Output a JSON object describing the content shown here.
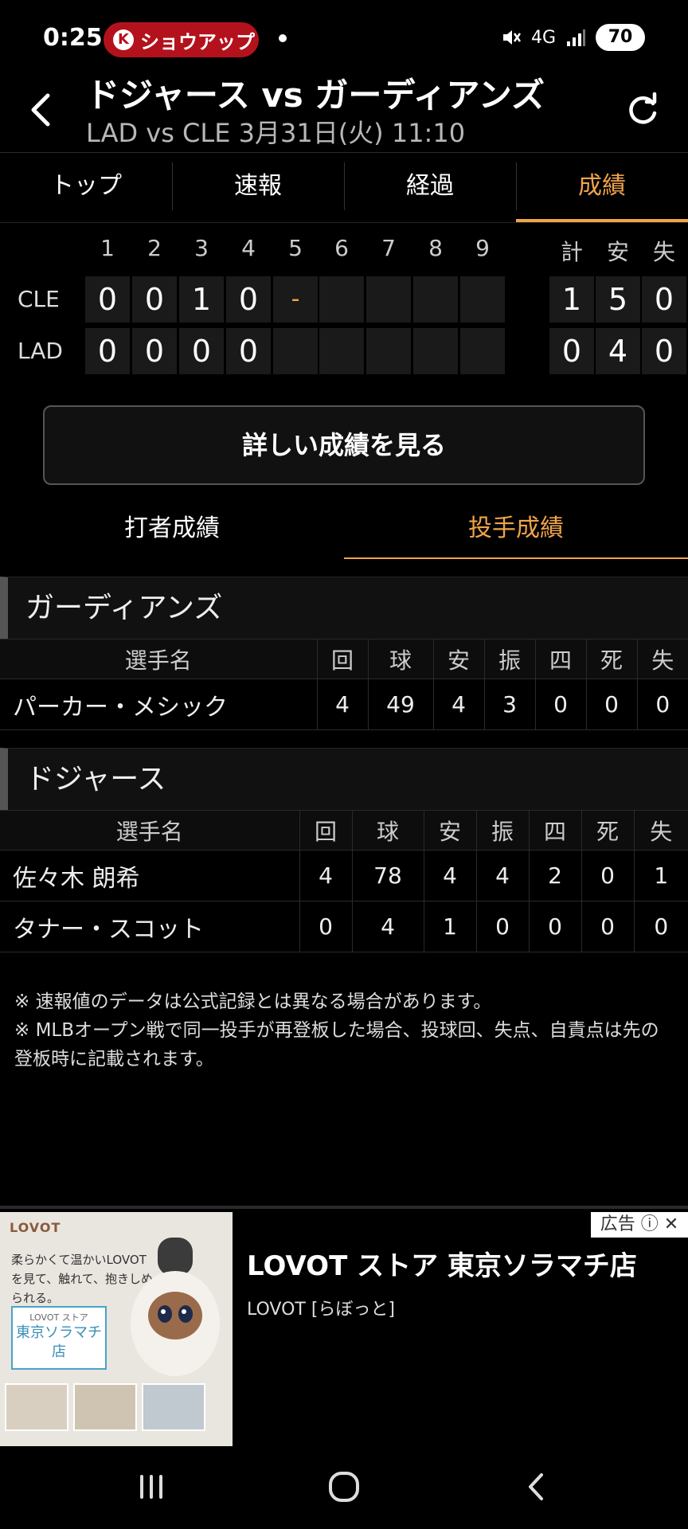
{
  "status_bar": {
    "time": "0:25",
    "notification_pill": "ショウアップ",
    "network": "4G",
    "battery": "70"
  },
  "header": {
    "title": "ドジャース vs ガーディアンズ",
    "subtitle": "LAD vs CLE 3月31日(火) 11:10"
  },
  "tabs": [
    "トップ",
    "速報",
    "経過",
    "成績"
  ],
  "active_tab": "成績",
  "scoreboard": {
    "innings": [
      "1",
      "2",
      "3",
      "4",
      "5",
      "6",
      "7",
      "8",
      "9"
    ],
    "totals_headers": [
      "計",
      "安",
      "失"
    ],
    "teams": [
      {
        "abbr": "CLE",
        "scores": [
          "0",
          "0",
          "1",
          "0",
          "-",
          "",
          "",
          "",
          ""
        ],
        "totals": [
          "1",
          "5",
          "0"
        ]
      },
      {
        "abbr": "LAD",
        "scores": [
          "0",
          "0",
          "0",
          "0",
          "",
          "",
          "",
          "",
          ""
        ],
        "totals": [
          "0",
          "4",
          "0"
        ]
      }
    ]
  },
  "detail_button": "詳しい成績を見る",
  "stat_tabs": {
    "batting": "打者成績",
    "pitching": "投手成績"
  },
  "pitching": {
    "columns": [
      "選手名",
      "回",
      "球",
      "安",
      "振",
      "四",
      "死",
      "失"
    ],
    "teams": [
      {
        "name": "ガーディアンズ",
        "rows": [
          [
            "パーカー・メシック",
            "4",
            "49",
            "4",
            "3",
            "0",
            "0",
            "0"
          ]
        ]
      },
      {
        "name": "ドジャース",
        "rows": [
          [
            "佐々木 朗希",
            "4",
            "78",
            "4",
            "4",
            "2",
            "0",
            "1"
          ],
          [
            "タナー・スコット",
            "0",
            "4",
            "1",
            "0",
            "0",
            "0",
            "0"
          ]
        ]
      }
    ]
  },
  "notes": [
    "※ 速報値のデータは公式記録とは異なる場合があります。",
    "※ MLBオープン戦で同一投手が再登板した場合、投球回、失点、自責点は先の登板時に記載されます。"
  ],
  "ad": {
    "label": "広告",
    "logo": "LOVOT",
    "image_copy": "柔らかくて温かいLOVOTを見て、触れて、抱きしめられる。",
    "image_store_small": "LOVOT ストア",
    "image_store": "東京ソラマチ店",
    "title": "LOVOT ストア 東京ソラマチ店",
    "subtitle": "LOVOT [らぼっと]"
  },
  "colors": {
    "accent": "#f0a44a",
    "pill": "#b3121c",
    "background": "#000000"
  }
}
